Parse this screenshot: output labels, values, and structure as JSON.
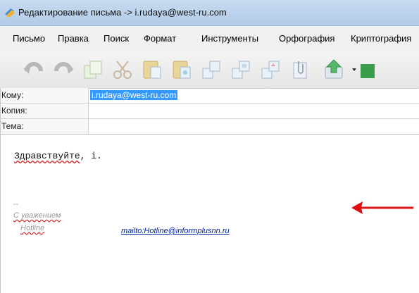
{
  "window": {
    "title": "Редактирование письма -> i.rudaya@west-ru.com"
  },
  "menu": [
    "Письмо",
    "Правка",
    "Поиск",
    "Формат",
    "Инструменты",
    "Орфография",
    "Криптография"
  ],
  "toolbar": {
    "icons": [
      "undo-icon",
      "redo-icon",
      "copy-icon",
      "cut-icon",
      "paste-icon",
      "paste-special-icon",
      "save-icon",
      "save-as-icon",
      "insert-icon",
      "attach-icon",
      "send-icon"
    ]
  },
  "fields": {
    "to": {
      "label": "Кому:",
      "value": "i.rudaya@west-ru.com"
    },
    "cc": {
      "label": "Копия:",
      "value": ""
    },
    "subject": {
      "label": "Тема:",
      "value": ""
    }
  },
  "body": {
    "greeting_word": "Здравствуйте",
    "greeting_rest": ", i.",
    "sig_dash": "--",
    "sig_line1": "С уважением",
    "sig_line2": "Hotline",
    "sig_link": "mailto:Hotline@informplusnn.ru"
  },
  "colors": {
    "selection": "#3399ff",
    "arrow": "#e01010",
    "link": "#0022aa"
  }
}
